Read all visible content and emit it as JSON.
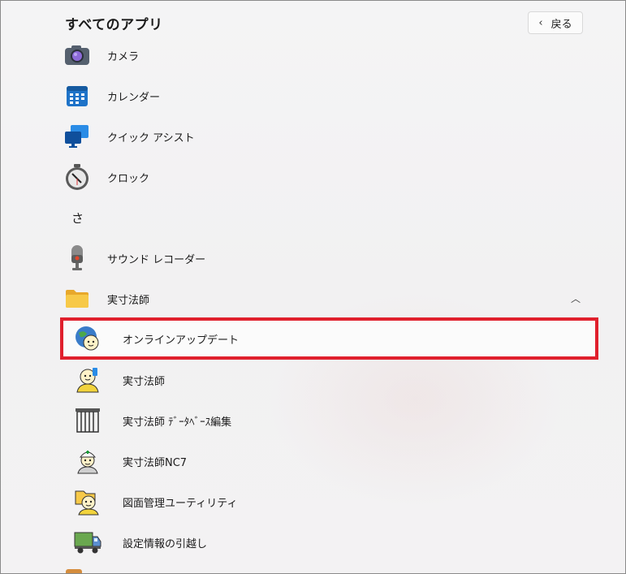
{
  "header": {
    "title": "すべてのアプリ",
    "back_label": "戻る"
  },
  "apps": [
    {
      "label": "カメラ",
      "icon": "camera-icon"
    },
    {
      "label": "カレンダー",
      "icon": "calendar-icon"
    },
    {
      "label": "クイック アシスト",
      "icon": "quick-assist-icon"
    },
    {
      "label": "クロック",
      "icon": "clock-icon"
    }
  ],
  "section_letter": "さ",
  "apps2": [
    {
      "label": "サウンド レコーダー",
      "icon": "microphone-icon"
    }
  ],
  "folder": {
    "label": "実寸法師",
    "icon": "folder-icon",
    "items": [
      {
        "label": "オンラインアップデート",
        "icon": "globe-character-icon",
        "highlighted": true
      },
      {
        "label": "実寸法師",
        "icon": "character-icon"
      },
      {
        "label": "実寸法師 ﾃﾞｰﾀﾍﾞｰｽ編集",
        "icon": "database-icon"
      },
      {
        "label": "実寸法師NC7",
        "icon": "helmet-character-icon"
      },
      {
        "label": "図面管理ユーティリティ",
        "icon": "folder-character-icon"
      },
      {
        "label": "設定情報の引越し",
        "icon": "truck-icon"
      }
    ]
  },
  "colors": {
    "highlight_border": "#e0202d",
    "folder": "#f7c948",
    "accent_blue": "#1e73c8"
  }
}
